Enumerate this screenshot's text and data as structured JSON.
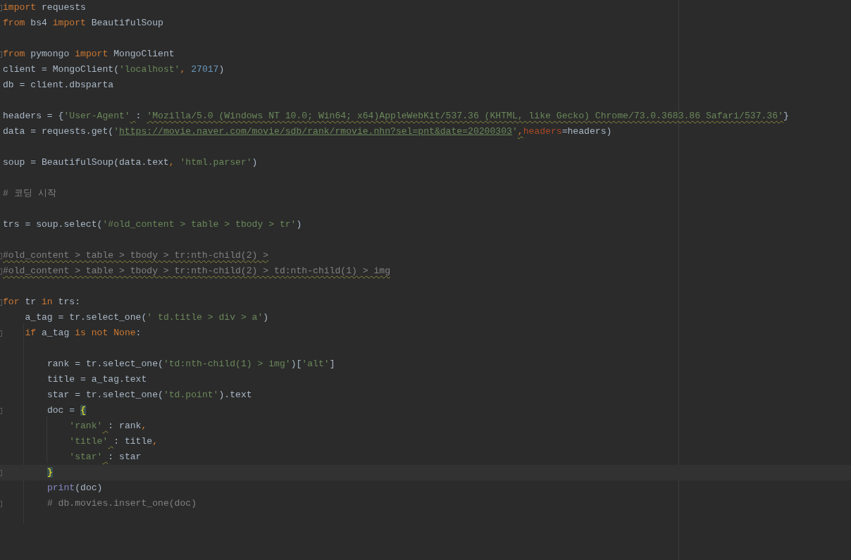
{
  "editor": {
    "lines": [
      {
        "kind": "code",
        "fold": true,
        "current": false,
        "tokens": [
          {
            "text": "import",
            "kind": "keyword"
          },
          {
            "text": " requests",
            "kind": "plain"
          }
        ]
      },
      {
        "kind": "code",
        "fold": false,
        "current": false,
        "tokens": [
          {
            "text": "from",
            "kind": "keyword"
          },
          {
            "text": " bs4 ",
            "kind": "plain"
          },
          {
            "text": "import",
            "kind": "keyword"
          },
          {
            "text": " BeautifulSoup",
            "kind": "plain"
          }
        ]
      },
      {
        "kind": "blank"
      },
      {
        "kind": "code",
        "fold": true,
        "current": false,
        "tokens": [
          {
            "text": "from",
            "kind": "keyword"
          },
          {
            "text": " pymongo ",
            "kind": "plain"
          },
          {
            "text": "import",
            "kind": "keyword"
          },
          {
            "text": " MongoClient",
            "kind": "plain"
          }
        ]
      },
      {
        "kind": "code",
        "fold": false,
        "current": false,
        "tokens": [
          {
            "text": "client = MongoClient(",
            "kind": "plain"
          },
          {
            "text": "'localhost'",
            "kind": "string"
          },
          {
            "text": ", ",
            "kind": "keyword"
          },
          {
            "text": "27017",
            "kind": "number"
          },
          {
            "text": ")",
            "kind": "plain"
          }
        ]
      },
      {
        "kind": "code",
        "fold": false,
        "current": false,
        "tokens": [
          {
            "text": "db = client.dbsparta",
            "kind": "plain"
          }
        ]
      },
      {
        "kind": "blank"
      },
      {
        "kind": "code",
        "fold": false,
        "current": false,
        "tokens": [
          {
            "text": "headers = {",
            "kind": "plain"
          },
          {
            "text": "'User-Agent'",
            "kind": "string",
            "warning_after": true
          },
          {
            "text": ": ",
            "kind": "plain"
          },
          {
            "text": "'Mozilla/5.0 (Windows NT 10.0; Win64; x64)AppleWebKit/537.36 (KHTML, like Gecko) Chrome/73.0.3683.86 Safari/537.36'",
            "kind": "string",
            "warning": true
          },
          {
            "text": "}",
            "kind": "plain"
          }
        ]
      },
      {
        "kind": "code",
        "fold": false,
        "current": false,
        "tokens": [
          {
            "text": "data = requests.get(",
            "kind": "plain"
          },
          {
            "text": "'",
            "kind": "string"
          },
          {
            "text": "https://movie.naver.com/movie/sdb/rank/rmovie.nhn?sel=pnt&date=20200303",
            "kind": "link"
          },
          {
            "text": "'",
            "kind": "string"
          },
          {
            "text": ",",
            "kind": "keyword",
            "warning": true
          },
          {
            "text": "headers",
            "kind": "param"
          },
          {
            "text": "=headers)",
            "kind": "plain"
          }
        ]
      },
      {
        "kind": "blank"
      },
      {
        "kind": "code",
        "fold": false,
        "current": false,
        "tokens": [
          {
            "text": "soup = BeautifulSoup(data.text",
            "kind": "plain"
          },
          {
            "text": ", ",
            "kind": "keyword"
          },
          {
            "text": "'html.parser'",
            "kind": "string"
          },
          {
            "text": ")",
            "kind": "plain"
          }
        ]
      },
      {
        "kind": "blank"
      },
      {
        "kind": "code",
        "fold": false,
        "current": false,
        "tokens": [
          {
            "text": "# 코딩 시작",
            "kind": "comment"
          }
        ]
      },
      {
        "kind": "blank"
      },
      {
        "kind": "code",
        "fold": false,
        "current": false,
        "tokens": [
          {
            "text": "trs = soup.select(",
            "kind": "plain"
          },
          {
            "text": "'#old_content > table > tbody > tr'",
            "kind": "string"
          },
          {
            "text": ")",
            "kind": "plain"
          }
        ]
      },
      {
        "kind": "blank"
      },
      {
        "kind": "code",
        "fold": true,
        "current": false,
        "tokens": [
          {
            "text": "#old_content > table > tbody > tr:nth-child(2) >",
            "kind": "comment",
            "warning": true
          }
        ]
      },
      {
        "kind": "code",
        "fold": true,
        "current": false,
        "tokens": [
          {
            "text": "#old_content > table > tbody > tr:nth-child(2) > td:nth-child(1) > img",
            "kind": "comment",
            "warning": true
          }
        ]
      },
      {
        "kind": "blank"
      },
      {
        "kind": "code",
        "fold": true,
        "current": false,
        "tokens": [
          {
            "text": "for",
            "kind": "keyword"
          },
          {
            "text": " tr ",
            "kind": "plain"
          },
          {
            "text": "in",
            "kind": "keyword"
          },
          {
            "text": " trs:",
            "kind": "plain"
          }
        ]
      },
      {
        "kind": "code",
        "fold": false,
        "current": false,
        "tokens": [
          {
            "text": "    a_tag = tr.select_one(",
            "kind": "plain"
          },
          {
            "text": "' td.title > div > a'",
            "kind": "string"
          },
          {
            "text": ")",
            "kind": "plain"
          }
        ]
      },
      {
        "kind": "code",
        "fold": true,
        "current": false,
        "tokens": [
          {
            "text": "    if",
            "kind": "keyword"
          },
          {
            "text": " a_tag ",
            "kind": "plain"
          },
          {
            "text": "is not None",
            "kind": "keyword"
          },
          {
            "text": ":",
            "kind": "plain"
          }
        ]
      },
      {
        "kind": "blank"
      },
      {
        "kind": "code",
        "fold": false,
        "current": false,
        "tokens": [
          {
            "text": "        rank = tr.select_one(",
            "kind": "plain"
          },
          {
            "text": "'td:nth-child(1) > img'",
            "kind": "string"
          },
          {
            "text": ")[",
            "kind": "plain"
          },
          {
            "text": "'alt'",
            "kind": "string"
          },
          {
            "text": "]",
            "kind": "plain"
          }
        ]
      },
      {
        "kind": "code",
        "fold": false,
        "current": false,
        "tokens": [
          {
            "text": "        title = a_tag.text",
            "kind": "plain"
          }
        ]
      },
      {
        "kind": "code",
        "fold": false,
        "current": false,
        "tokens": [
          {
            "text": "        star = tr.select_one(",
            "kind": "plain"
          },
          {
            "text": "'td.point'",
            "kind": "string"
          },
          {
            "text": ").text",
            "kind": "plain"
          }
        ]
      },
      {
        "kind": "code",
        "fold": true,
        "current": false,
        "tokens": [
          {
            "text": "        doc = ",
            "kind": "plain"
          },
          {
            "text": "{",
            "kind": "brace_match"
          }
        ]
      },
      {
        "kind": "code",
        "fold": false,
        "current": false,
        "tokens": [
          {
            "text": "            'rank'",
            "kind": "string",
            "warning_after": true
          },
          {
            "text": ": rank",
            "kind": "plain"
          },
          {
            "text": ",",
            "kind": "keyword"
          }
        ]
      },
      {
        "kind": "code",
        "fold": false,
        "current": false,
        "tokens": [
          {
            "text": "            'title'",
            "kind": "string",
            "warning_after": true
          },
          {
            "text": ": title",
            "kind": "plain"
          },
          {
            "text": ",",
            "kind": "keyword"
          }
        ]
      },
      {
        "kind": "code",
        "fold": false,
        "current": false,
        "tokens": [
          {
            "text": "            'star'",
            "kind": "string",
            "warning_after": true
          },
          {
            "text": ": star",
            "kind": "plain"
          }
        ]
      },
      {
        "kind": "code",
        "fold": true,
        "current": true,
        "tokens": [
          {
            "text": "        }",
            "kind": "brace_match"
          }
        ]
      },
      {
        "kind": "code",
        "fold": false,
        "current": false,
        "tokens": [
          {
            "text": "        print",
            "kind": "builtin"
          },
          {
            "text": "(doc)",
            "kind": "plain"
          }
        ]
      },
      {
        "kind": "code",
        "fold": true,
        "current": false,
        "tokens": [
          {
            "text": "        # db.movies.insert_one(doc)",
            "kind": "comment"
          }
        ]
      }
    ]
  }
}
